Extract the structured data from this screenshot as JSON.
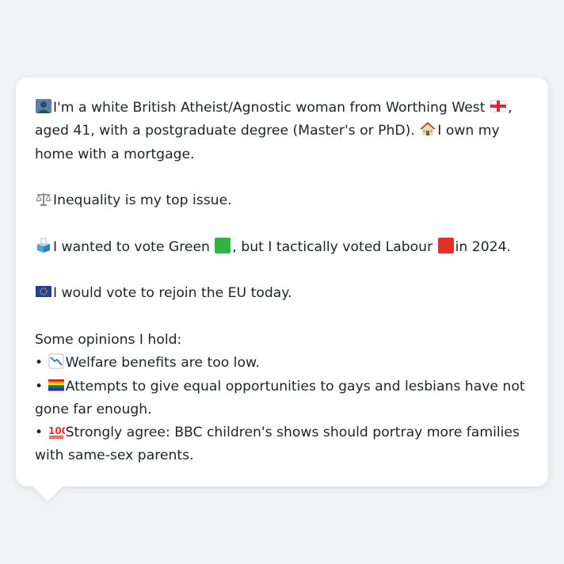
{
  "profile": {
    "intro_a": "I'm a white British Atheist/Agnostic woman from Worthing West",
    "intro_b": ", aged 41, with a postgraduate degree (Master's or PhD).",
    "intro_c": "I own my home with a mortgage.",
    "issue": "Inequality is my top issue.",
    "vote_a": "I wanted to vote Green",
    "vote_b": ", but I tactically voted Labour",
    "vote_c": "in 2024.",
    "eu": "I would vote to rejoin the EU today.",
    "opinions_heading": "Some opinions I hold:",
    "bullet_char": "•",
    "opinions": [
      "Welfare benefits are too low.",
      "Attempts to give equal opportunities to gays and lesbians have not gone far enough.",
      "Strongly agree: BBC children's shows should portray more families with same-sex parents."
    ]
  },
  "icons": {
    "person": "person-silhouette-icon",
    "england_flag": "england-flag-icon",
    "house": "house-icon",
    "scales": "balance-scale-icon",
    "ballot_box": "ballot-box-icon",
    "green_square": "green-square-icon",
    "red_square": "red-square-icon",
    "eu_flag": "eu-flag-icon",
    "chart_down": "chart-decreasing-icon",
    "rainbow_flag": "rainbow-flag-icon",
    "hundred": "hundred-points-icon"
  },
  "colors": {
    "background": "#f2f3f5",
    "card": "#ffffff",
    "text": "#1f2328",
    "green": "#2fb344",
    "red": "#e0312a",
    "eu_blue": "#1f3f99"
  }
}
